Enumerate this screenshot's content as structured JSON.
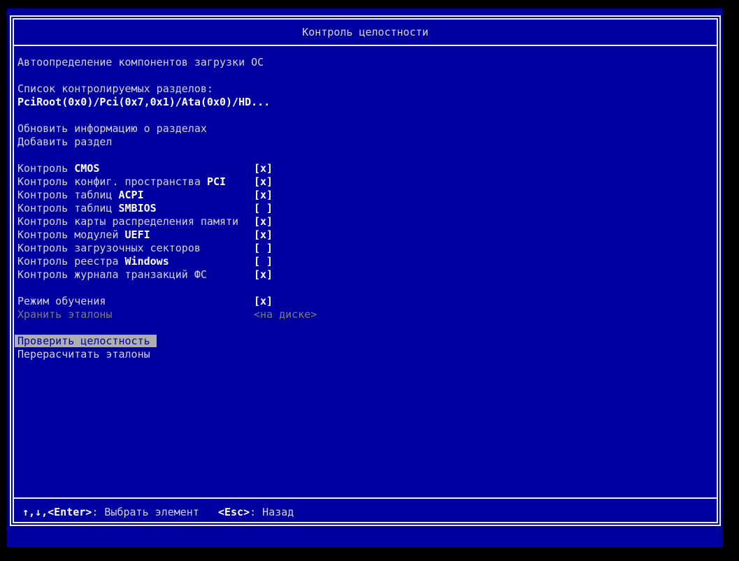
{
  "title": "Контроль целостности",
  "colors": {
    "background": "#0000A0",
    "frame": "#F0F0F0",
    "text_normal": "#D4D4D4",
    "text_bright": "#FFFFFF",
    "text_disabled": "#7C7C7C",
    "highlight_bg": "#AEAEAE",
    "highlight_text": "#0000A0"
  },
  "intro": {
    "auto_detect": "Автоопределение компонентов загрузки ОС",
    "partitions_label": "Список контролируемых разделов:",
    "partition_path": "PciRoot(0x0)/Pci(0x7,0x1)/Ata(0x0)/HD..."
  },
  "partition_actions": [
    {
      "label": "Обновить информацию о разделах"
    },
    {
      "label": "Добавить раздел"
    }
  ],
  "checks": [
    {
      "pre": "Контроль ",
      "em": "CMOS",
      "state": "[x]"
    },
    {
      "pre": "Контроль конфиг. пространства ",
      "em": "PCI",
      "state": "[x]"
    },
    {
      "pre": "Контроль таблиц ",
      "em": "ACPI",
      "state": "[x]"
    },
    {
      "pre": "Контроль таблиц ",
      "em": "SMBIOS",
      "state": "[ ]"
    },
    {
      "pre": "Контроль карты распределения памяти",
      "em": "",
      "state": "[x]"
    },
    {
      "pre": "Контроль модулей ",
      "em": "UEFI",
      "state": "[x]"
    },
    {
      "pre": "Контроль загрузочных секторов",
      "em": "",
      "state": "[ ]"
    },
    {
      "pre": "Контроль реестра ",
      "em": "Windows",
      "state": "[ ]"
    },
    {
      "pre": "Контроль журнала транзакций ФС",
      "em": "",
      "state": "[x]"
    }
  ],
  "options": {
    "learning_mode": {
      "label": "Режим обучения",
      "state": "[x]"
    },
    "store_etalons": {
      "label": "Хранить эталоны",
      "value": "<на диске>"
    }
  },
  "commands": [
    {
      "label": "Проверить целостность",
      "selected": true
    },
    {
      "label": "Перерасчитать эталоны",
      "selected": false
    }
  ],
  "footer": {
    "nav_keys": "↑,↓,<Enter>",
    "nav_desc": ": Выбрать элемент",
    "spacer": "   ",
    "back_keys": "<Esc>",
    "back_desc": ": Назад"
  }
}
